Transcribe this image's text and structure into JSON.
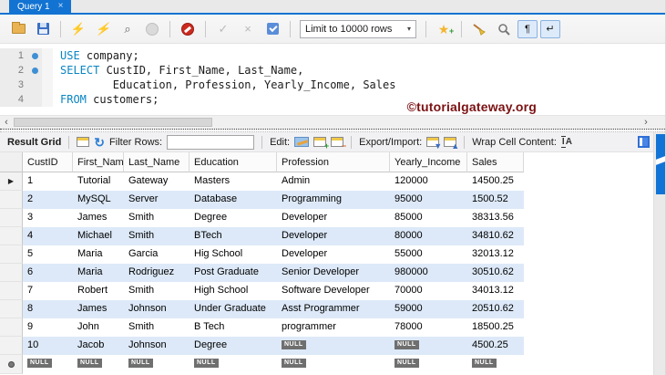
{
  "tab": {
    "title": "Query 1"
  },
  "icons": {
    "close": "×",
    "caret": "▾",
    "bolt": "⚡",
    "check": "✓",
    "cross": "×",
    "pilcrow": "¶",
    "wrap_return": "↵",
    "refresh": "↻",
    "star": "★",
    "star_plus": "+",
    "magnifier": "⌕",
    "hscroll_left": "‹",
    "hscroll_right": "›",
    "row_arrow": "▶",
    "grid_plus": "+",
    "grid_minus": "−",
    "export_badge": "▼",
    "import_badge": "▲",
    "wrap_I": "I",
    "wrap_A": "A"
  },
  "toolbar": {
    "limit_dropdown": "Limit to 10000 rows"
  },
  "editor": {
    "watermark": "©tutorialgateway.org",
    "lines": [
      {
        "n": "1",
        "dot": true,
        "segs": [
          {
            "k": true,
            "t": "USE"
          },
          {
            "t": " company;"
          }
        ]
      },
      {
        "n": "2",
        "dot": true,
        "segs": [
          {
            "k": true,
            "t": "SELECT"
          },
          {
            "t": " CustID, First_Name, Last_Name,"
          }
        ]
      },
      {
        "n": "3",
        "dot": false,
        "segs": [
          {
            "t": "        Education, Profession, Yearly_Income, Sales"
          }
        ]
      },
      {
        "n": "4",
        "dot": false,
        "segs": [
          {
            "k": true,
            "t": "FROM"
          },
          {
            "t": " customers;"
          }
        ]
      }
    ]
  },
  "result_toolbar": {
    "title": "Result Grid",
    "filter_label": "Filter Rows:",
    "filter_value": "",
    "edit_label": "Edit:",
    "export_label": "Export/Import:",
    "wrap_label": "Wrap Cell Content:"
  },
  "table": {
    "null_token": "NULL",
    "columns": [
      "CustID",
      "First_Name",
      "Last_Name",
      "Education",
      "Profession",
      "Yearly_Income",
      "Sales"
    ],
    "rows": [
      [
        "1",
        "Tutorial",
        "Gateway",
        "Masters",
        "Admin",
        "120000",
        "14500.25"
      ],
      [
        "2",
        "MySQL",
        "Server",
        "Database",
        "Programming",
        "95000",
        "1500.52"
      ],
      [
        "3",
        "James",
        "Smith",
        "Degree",
        "Developer",
        "85000",
        "38313.56"
      ],
      [
        "4",
        "Michael",
        "Smith",
        "BTech",
        "Developer",
        "80000",
        "34810.62"
      ],
      [
        "5",
        "Maria",
        "Garcia",
        "Hig School",
        "Developer",
        "55000",
        "32013.12"
      ],
      [
        "6",
        "Maria",
        "Rodriguez",
        "Post Graduate",
        "Senior Developer",
        "980000",
        "30510.62"
      ],
      [
        "7",
        "Robert",
        "Smith",
        "High School",
        "Software Developer",
        "70000",
        "34013.12"
      ],
      [
        "8",
        "James",
        "Johnson",
        "Under Graduate",
        "Asst Programmer",
        "59000",
        "20510.62"
      ],
      [
        "9",
        "John",
        "Smith",
        "B Tech",
        "programmer",
        "78000",
        "18500.25"
      ],
      [
        "10",
        "Jacob",
        "Johnson",
        "Degree",
        null,
        null,
        "4500.25"
      ]
    ],
    "new_row": [
      null,
      null,
      null,
      null,
      null,
      null,
      null
    ]
  }
}
